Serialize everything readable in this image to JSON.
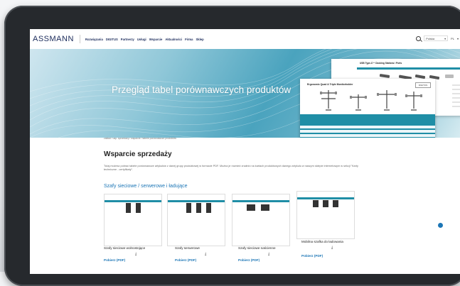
{
  "header": {
    "logo": "ASSMANN",
    "menu": [
      "Rozwiązania",
      "DIGITUS",
      "Partnerzy",
      "Usługi",
      "Wsparcie",
      "Aktualności",
      "Firma",
      "Sklep"
    ],
    "language": "Polska",
    "lang_code": "PL"
  },
  "hero": {
    "title": "Przegląd tabel porównawczych produktów",
    "doc1_title": "USB Type-C™ Docking Stations / Ports",
    "doc2_title": "Ergonomic Quad & Triple Monitorholder",
    "doc2_badge": "DIGITUS"
  },
  "breadcrumb": "zakład / usp. sprzedaży / wsparcie / tabele porównawcze produktów",
  "main": {
    "title": "Wsparcie sprzedaży",
    "description": "Tutaj możesz pobrać tabele porównawcze artykułów z danej grupy produktowej w formacie PDF. Można je również znaleźć na kartach produktowych danego artykułu w naszym sklepie internetowym w sekcji \"Karty techniczne - certyfikaty\".",
    "section_title": "Szafy sieciowe / serwerowe i ładujące",
    "cards": [
      {
        "label": "Szafy sieciowe wolnostojące",
        "link": "Pobierz (PDF)"
      },
      {
        "label": "Szafy serwerowe",
        "link": "Pobierz (PDF)"
      },
      {
        "label": "Szafy sieciowe naścienne",
        "link": "Pobierz (PDF)"
      },
      {
        "label": "Mobilna szafka do ładowania",
        "link": "Pobierz (PDF)"
      }
    ]
  }
}
